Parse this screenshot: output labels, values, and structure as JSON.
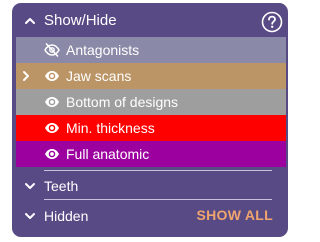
{
  "panel": {
    "title": "Show/Hide",
    "help_icon": "help-circle-icon"
  },
  "items": [
    {
      "label": "Antagonists",
      "visible": false,
      "color": "#8a8aa8",
      "icon": "eye-off-icon",
      "current": false
    },
    {
      "label": "Jaw scans",
      "visible": true,
      "color": "#bb9566",
      "icon": "eye-icon",
      "current": true
    },
    {
      "label": "Bottom of designs",
      "visible": true,
      "color": "#9e9e9e",
      "icon": "eye-icon",
      "current": false
    },
    {
      "label": "Min. thickness",
      "visible": true,
      "color": "#ff0000",
      "icon": "eye-icon",
      "current": false
    },
    {
      "label": "Full anatomic",
      "visible": true,
      "color": "#9c019f",
      "icon": "eye-icon",
      "current": false
    }
  ],
  "sections": {
    "teeth": {
      "label": "Teeth"
    },
    "hidden": {
      "label": "Hidden",
      "action_label": "SHOW ALL"
    }
  },
  "colors": {
    "panel_bg": "#574a85",
    "accent": "#f0a46e"
  }
}
